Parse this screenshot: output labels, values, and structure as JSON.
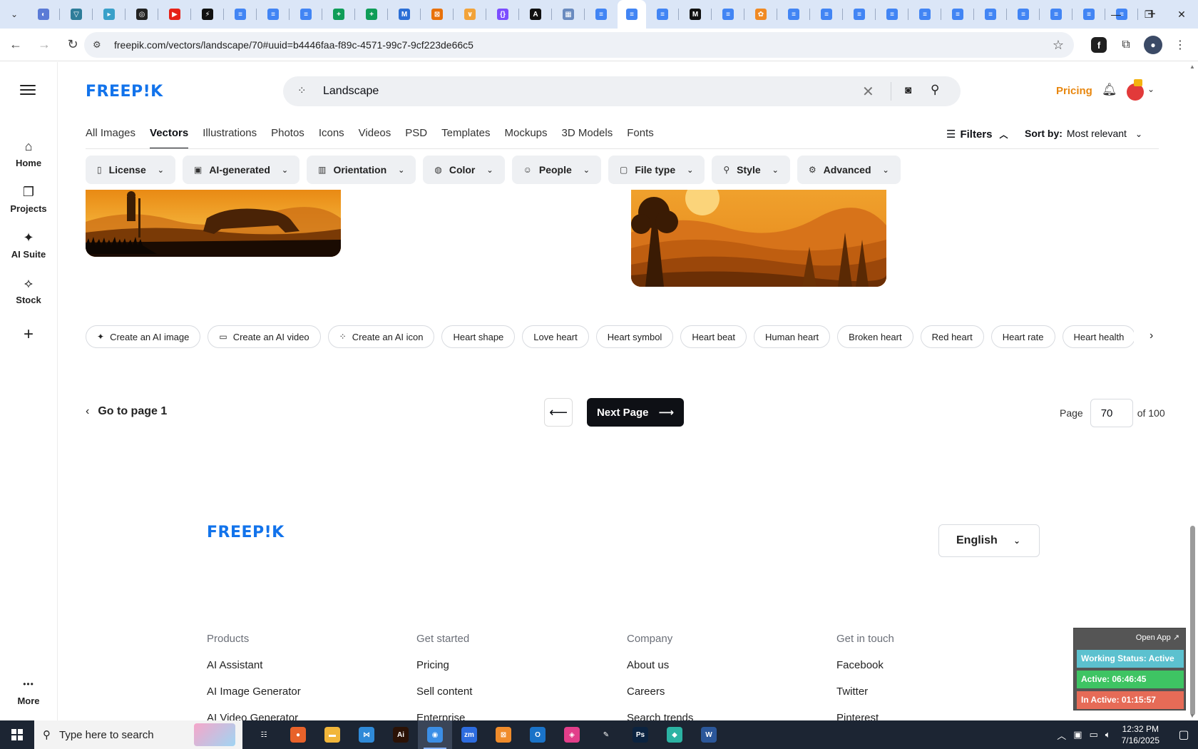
{
  "browser": {
    "url": "freepik.com/vectors/landscape/70#uuid=b4446faa-f89c-4571-99c7-9cf223de66c5",
    "new_tab": "+",
    "tab_favicons": [
      {
        "color": "#5b7bd6",
        "glyph": "◐"
      },
      {
        "color": "#2e7d9a",
        "glyph": "▽"
      },
      {
        "color": "#39a0c9",
        "glyph": "▸"
      },
      {
        "color": "#222222",
        "glyph": "◎"
      },
      {
        "color": "#e62117",
        "glyph": "▶"
      },
      {
        "color": "#111111",
        "glyph": "⚡"
      },
      {
        "color": "#4285f4",
        "glyph": "≡"
      },
      {
        "color": "#4285f4",
        "glyph": "≡"
      },
      {
        "color": "#4285f4",
        "glyph": "≡"
      },
      {
        "color": "#0f9d58",
        "glyph": "+"
      },
      {
        "color": "#0f9d58",
        "glyph": "+"
      },
      {
        "color": "#2b6fd6",
        "glyph": "M"
      },
      {
        "color": "#e8710a",
        "glyph": "⊠"
      },
      {
        "color": "#f2a33a",
        "glyph": "∨"
      },
      {
        "color": "#7c4dff",
        "glyph": "{}"
      },
      {
        "color": "#111111",
        "glyph": "A"
      },
      {
        "color": "#6a8bbf",
        "glyph": "▦"
      },
      {
        "color": "#4285f4",
        "glyph": "≡"
      },
      {
        "color": "#4285f4",
        "glyph": "≡"
      },
      {
        "color": "#4285f4",
        "glyph": "≡"
      },
      {
        "color": "#111111",
        "glyph": "M"
      },
      {
        "color": "#4285f4",
        "glyph": "≡"
      },
      {
        "color": "#f08a24",
        "glyph": "✿"
      },
      {
        "color": "#4285f4",
        "glyph": "≡"
      },
      {
        "color": "#4285f4",
        "glyph": "≡"
      },
      {
        "color": "#4285f4",
        "glyph": "≡"
      },
      {
        "color": "#4285f4",
        "glyph": "≡"
      },
      {
        "color": "#4285f4",
        "glyph": "≡"
      },
      {
        "color": "#4285f4",
        "glyph": "≡"
      },
      {
        "color": "#4285f4",
        "glyph": "≡"
      },
      {
        "color": "#4285f4",
        "glyph": "≡"
      },
      {
        "color": "#4285f4",
        "glyph": "≡"
      },
      {
        "color": "#4285f4",
        "glyph": "≡"
      },
      {
        "color": "#4285f4",
        "glyph": "≡"
      }
    ],
    "active_tab_index": 18
  },
  "brand": {
    "logo": "FREEP!K",
    "color": "#1273eb"
  },
  "rail": [
    {
      "label": "Home",
      "icon": "home-icon",
      "glyph": "⌂"
    },
    {
      "label": "Projects",
      "icon": "projects-icon",
      "glyph": "❐"
    },
    {
      "label": "AI Suite",
      "icon": "ai-suite-icon",
      "glyph": "✦"
    },
    {
      "label": "Stock",
      "icon": "stock-icon",
      "glyph": "⟡"
    },
    {
      "label": "More",
      "icon": "more-icon",
      "glyph": "•••"
    }
  ],
  "search": {
    "value": "Landscape"
  },
  "header": {
    "pricing": "Pricing",
    "pricing_color": "#e8870f"
  },
  "category_tabs": [
    "All Images",
    "Vectors",
    "Illustrations",
    "Photos",
    "Icons",
    "Videos",
    "PSD",
    "Templates",
    "Mockups",
    "3D Models",
    "Fonts"
  ],
  "active_category": "Vectors",
  "filters": {
    "label": "Filters",
    "sort_label": "Sort by:",
    "sort_value": "Most relevant"
  },
  "filter_chips": [
    {
      "label": "License",
      "glyph": "▯"
    },
    {
      "label": "AI-generated",
      "glyph": "▣"
    },
    {
      "label": "Orientation",
      "glyph": "▥"
    },
    {
      "label": "Color",
      "glyph": "◍"
    },
    {
      "label": "People",
      "glyph": "☺"
    },
    {
      "label": "File type",
      "glyph": "▢"
    },
    {
      "label": "Style",
      "glyph": "⚲"
    },
    {
      "label": "Advanced",
      "glyph": "⚙"
    }
  ],
  "related_chips": [
    {
      "label": "Create an AI image",
      "glyph": "✦"
    },
    {
      "label": "Create an AI video",
      "glyph": "▭"
    },
    {
      "label": "Create an AI icon",
      "glyph": "⁘"
    },
    {
      "label": "Heart shape"
    },
    {
      "label": "Love heart"
    },
    {
      "label": "Heart symbol"
    },
    {
      "label": "Heart beat"
    },
    {
      "label": "Human heart"
    },
    {
      "label": "Broken heart"
    },
    {
      "label": "Red heart"
    },
    {
      "label": "Heart rate"
    },
    {
      "label": "Heart health"
    }
  ],
  "pagination": {
    "goto": "Go to page 1",
    "next": "Next Page",
    "page_label": "Page",
    "current": "70",
    "of_total": "of 100"
  },
  "footer": {
    "language": "English",
    "columns": [
      {
        "heading": "Products",
        "links": [
          "AI Assistant",
          "AI Image Generator",
          "AI Video Generator"
        ]
      },
      {
        "heading": "Get started",
        "links": [
          "Pricing",
          "Sell content",
          "Enterprise"
        ]
      },
      {
        "heading": "Company",
        "links": [
          "About us",
          "Careers",
          "Search trends"
        ]
      },
      {
        "heading": "Get in touch",
        "links": [
          "Facebook",
          "Twitter",
          "Pinterest"
        ]
      }
    ]
  },
  "widget": {
    "open_app": "Open App ↗",
    "status": "Working Status: Active",
    "active": "Active: 06:46:45",
    "inactive": "In Active: 01:15:57",
    "status_color": "#5cc1cf",
    "active_color": "#3ec463",
    "inactive_color": "#e66b57"
  },
  "taskbar": {
    "search_placeholder": "Type here to search",
    "apps": [
      {
        "glyph": "☷",
        "color": "#1c2533"
      },
      {
        "glyph": "●",
        "color": "#e8622a"
      },
      {
        "glyph": "▬",
        "color": "#f1b63a"
      },
      {
        "glyph": "⋈",
        "color": "#2f8ad8"
      },
      {
        "glyph": "Ai",
        "color": "#2b1206"
      },
      {
        "glyph": "◉",
        "color": "#3b8ee6"
      },
      {
        "glyph": "zm",
        "color": "#2d6cdf"
      },
      {
        "glyph": "⊠",
        "color": "#f08c2b"
      },
      {
        "glyph": "O",
        "color": "#1a73c8"
      },
      {
        "glyph": "◈",
        "color": "#e23e8a"
      },
      {
        "glyph": "✎",
        "color": "#1c2533"
      },
      {
        "glyph": "Ps",
        "color": "#0b2340"
      },
      {
        "glyph": "◆",
        "color": "#2bb3a3"
      },
      {
        "glyph": "W",
        "color": "#2b579a"
      }
    ],
    "active_app_index": 5,
    "time": "12:32 PM",
    "date": "7/16/2025"
  }
}
